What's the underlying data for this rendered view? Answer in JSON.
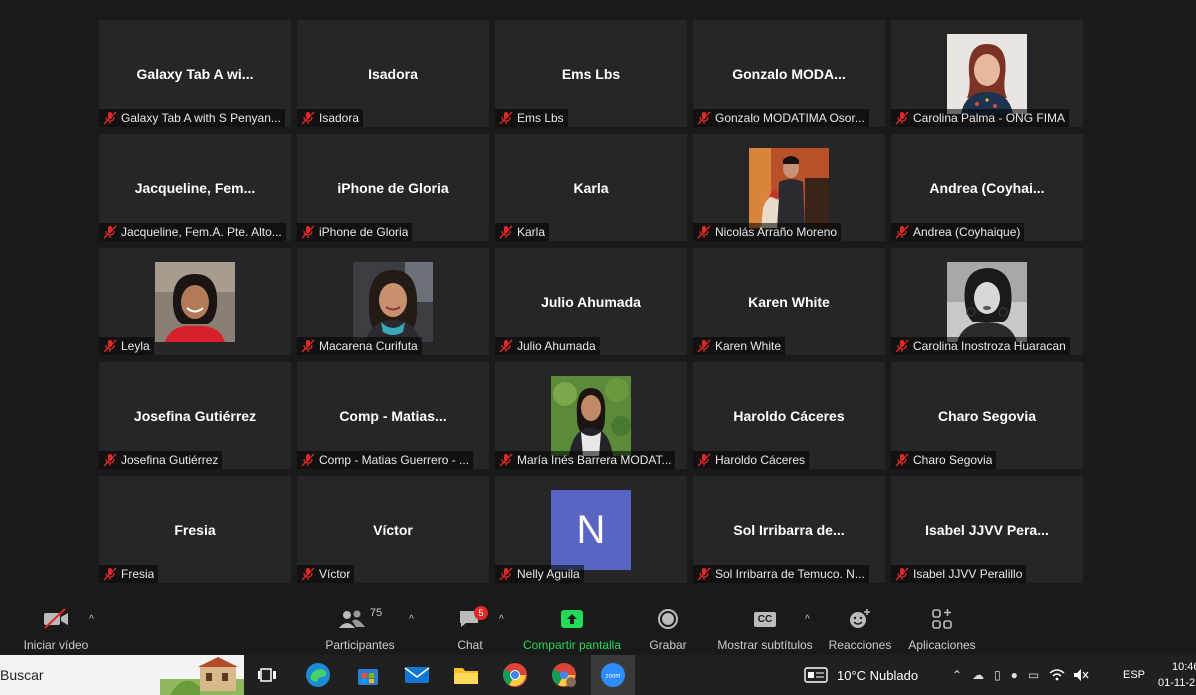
{
  "participants": [
    {
      "big": "Galaxy Tab A wi...",
      "name": "Galaxy Tab A with S Penyan..."
    },
    {
      "big": "Isadora",
      "name": "Isadora"
    },
    {
      "big": "Ems Lbs",
      "name": "Ems Lbs"
    },
    {
      "big": "Gonzalo  MODA...",
      "name": "Gonzalo MODATIMA Osor..."
    },
    {
      "big": "",
      "name": "Carolina Palma - ONG FIMA",
      "photo": "woman-red-hair"
    },
    {
      "big": "Jacqueline,  Fem...",
      "name": "Jacqueline, Fem.A. Pte. Alto..."
    },
    {
      "big": "iPhone de Gloria",
      "name": "iPhone de Gloria"
    },
    {
      "big": "Karla",
      "name": "Karla"
    },
    {
      "big": "",
      "name": "Nicolás Arraño Moreno",
      "photo": "man-red-room"
    },
    {
      "big": "Andrea  (Coyhai...",
      "name": "Andrea (Coyhaique)"
    },
    {
      "big": "",
      "name": "Leyla",
      "photo": "woman-smiling-red"
    },
    {
      "big": "",
      "name": "Macarena Curifuta",
      "photo": "woman-car"
    },
    {
      "big": "Julio Ahumada",
      "name": "Julio Ahumada"
    },
    {
      "big": "Karen White",
      "name": "Karen White"
    },
    {
      "big": "",
      "name": "Carolina Inostroza Huaracan",
      "photo": "woman-bw"
    },
    {
      "big": "Josefina Gutiérrez",
      "name": "Josefina Gutiérrez"
    },
    {
      "big": "Comp  -  Matias...",
      "name": "Comp - Matias Guerrero - ..."
    },
    {
      "big": "",
      "name": "María Inés Barrera MODAT...",
      "photo": "woman-green"
    },
    {
      "big": "Haroldo Cáceres",
      "name": "Haroldo Cáceres"
    },
    {
      "big": "Charo Segovia",
      "name": "Charo Segovia"
    },
    {
      "big": "Fresia",
      "name": "Fresia"
    },
    {
      "big": "Víctor",
      "name": "Víctor"
    },
    {
      "big": "",
      "name": "Nelly Aguila",
      "initial": "N"
    },
    {
      "big": "Sol  Irribarra  de...",
      "name": "Sol Irribarra de Temuco. N..."
    },
    {
      "big": "Isabel JJVV Pera...",
      "name": "Isabel JJVV Peralillo"
    }
  ],
  "toolbar": {
    "video_label": "Iniciar vídeo",
    "participants_label": "Participantes",
    "participants_count": "75",
    "chat_label": "Chat",
    "chat_badge": "5",
    "share_label": "Compartir pantalla",
    "record_label": "Grabar",
    "subtitles_label": "Mostrar subtítulos",
    "subtitles_icon_text": "CC",
    "reactions_label": "Reacciones",
    "apps_label": "Aplicaciones",
    "share_color": "#23d959",
    "mute_color": "#e02828"
  },
  "taskbar": {
    "search_text": "Buscar",
    "weather": "10°C  Nublado",
    "lang": "ESP",
    "time": "10:46",
    "date": "01-11-2"
  },
  "icons": [
    "mic-muted-icon",
    "video-off-icon",
    "participants-icon",
    "chat-icon",
    "share-screen-icon",
    "record-icon",
    "cc-icon",
    "reactions-icon",
    "apps-icon",
    "task-view-icon",
    "edge-icon",
    "store-icon",
    "mail-icon",
    "folder-icon",
    "chrome-icon",
    "zoom-icon",
    "weather-icon",
    "wifi-icon",
    "volume-icon"
  ]
}
